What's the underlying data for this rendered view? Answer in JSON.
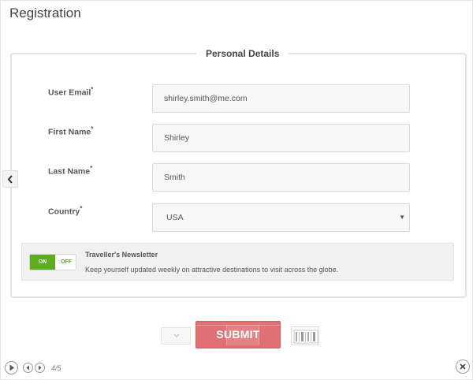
{
  "page": {
    "title": "Registration"
  },
  "form": {
    "legend": "Personal Details",
    "required_marker": "*",
    "fields": [
      {
        "label": "User Email",
        "value": "shirley.smith@me.com"
      },
      {
        "label": "First Name",
        "value": "Shirley"
      },
      {
        "label": "Last Name",
        "value": "Smith"
      }
    ],
    "country": {
      "label": "Country",
      "selected": "USA"
    }
  },
  "newsletter": {
    "toggle_on": "ON",
    "toggle_off": "OFF",
    "enabled": true,
    "title": "Traveller's Newsletter",
    "description": "Keep yourself updated weekly on attractive destinations to visit across the globe."
  },
  "actions": {
    "submit_label": "SUBMIT"
  },
  "player": {
    "page_counter": "4/5"
  },
  "colors": {
    "accent_green": "#5aad1e",
    "submit_red": "#e07074"
  },
  "icons": {
    "side": "chevron-left-icon",
    "play": "play-icon",
    "prev": "rewind-icon",
    "next": "forward-icon",
    "close": "close-icon",
    "dropdown": "caret-down-icon"
  }
}
